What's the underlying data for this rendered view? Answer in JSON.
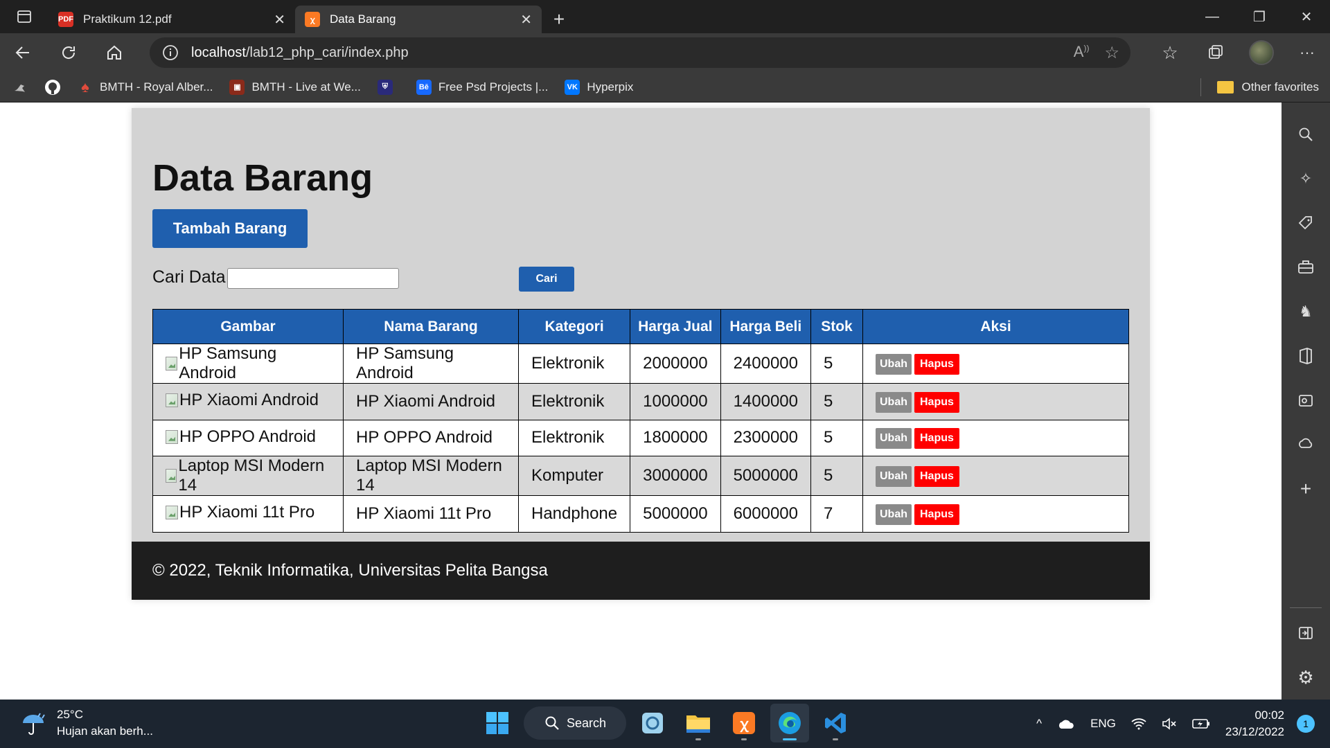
{
  "browser": {
    "tabs": [
      {
        "title": "Praktikum 12.pdf",
        "icon": "pdf-icon",
        "active": false
      },
      {
        "title": "Data Barang",
        "icon": "xampp-icon",
        "active": true
      }
    ],
    "url_host": "localhost",
    "url_path": "/lab12_php_cari/index.php",
    "bookmarks": [
      {
        "label": "BMTH - Royal Alber...",
        "icon": "spade-icon"
      },
      {
        "label": "BMTH - Live at We...",
        "icon": "cinema-icon"
      },
      {
        "label": "",
        "icon": "crest-icon"
      },
      {
        "label": "Free Psd Projects |...",
        "icon": "behance-icon"
      },
      {
        "label": "Hyperpix",
        "icon": "vk-icon"
      }
    ],
    "other_favorites": "Other favorites"
  },
  "page": {
    "title": "Data Barang",
    "add_button": "Tambah Barang",
    "search_label": "Cari Data",
    "search_value": "",
    "search_button": "Cari",
    "table": {
      "headers": [
        "Gambar",
        "Nama Barang",
        "Kategori",
        "Harga Jual",
        "Harga Beli",
        "Stok",
        "Aksi"
      ],
      "rows": [
        {
          "gambar_alt": "HP Samsung Android",
          "nama": "HP Samsung Android",
          "kategori": "Elektronik",
          "harga_jual": "2000000",
          "harga_beli": "2400000",
          "stok": "5"
        },
        {
          "gambar_alt": "HP Xiaomi Android",
          "nama": "HP Xiaomi Android",
          "kategori": "Elektronik",
          "harga_jual": "1000000",
          "harga_beli": "1400000",
          "stok": "5"
        },
        {
          "gambar_alt": "HP OPPO Android",
          "nama": "HP OPPO Android",
          "kategori": "Elektronik",
          "harga_jual": "1800000",
          "harga_beli": "2300000",
          "stok": "5"
        },
        {
          "gambar_alt": "Laptop MSI Modern 14",
          "nama": "Laptop MSI Modern 14",
          "kategori": "Komputer",
          "harga_jual": "3000000",
          "harga_beli": "5000000",
          "stok": "5"
        },
        {
          "gambar_alt": "HP Xiaomi 11t Pro",
          "nama": "HP Xiaomi 11t Pro",
          "kategori": "Handphone",
          "harga_jual": "5000000",
          "harga_beli": "6000000",
          "stok": "7"
        }
      ],
      "edit_label": "Ubah",
      "delete_label": "Hapus"
    },
    "footer": "© 2022, Teknik Informatika, Universitas Pelita Bangsa"
  },
  "taskbar": {
    "weather_temp": "25°C",
    "weather_desc": "Hujan akan berh...",
    "search_label": "Search",
    "lang": "ENG",
    "time": "00:02",
    "date": "23/12/2022",
    "notification_count": "1"
  },
  "colors": {
    "primary": "#1f5fae",
    "danger": "#ff0000",
    "edit": "#8a8a8a",
    "container_bg": "#d3d3d3",
    "footer_bg": "#1e1e1e"
  }
}
